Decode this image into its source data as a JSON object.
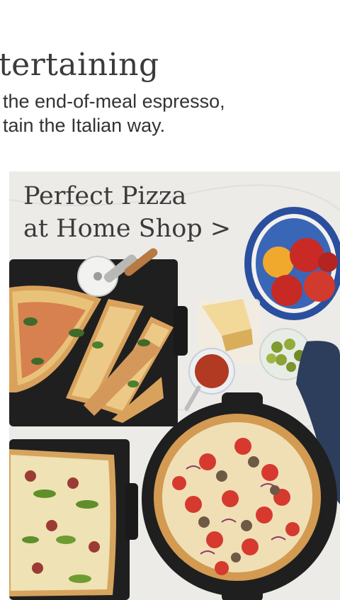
{
  "section": {
    "heading": "tertaining",
    "subtext_line1": "the end-of-meal espresso,",
    "subtext_line2": "tain the Italian way."
  },
  "promo": {
    "title_line1": "Perfect Pizza",
    "title_line2": "at Home Shop >"
  },
  "colors": {
    "background": "#ffffff",
    "heading_text": "#3b3b3b",
    "body_text": "#333333",
    "hero_bg": "#ededeb",
    "pan": "#1f1f1f",
    "crust": "#d9a25c",
    "sauce": "#c0392b",
    "bowl": "#2a4f9e"
  }
}
